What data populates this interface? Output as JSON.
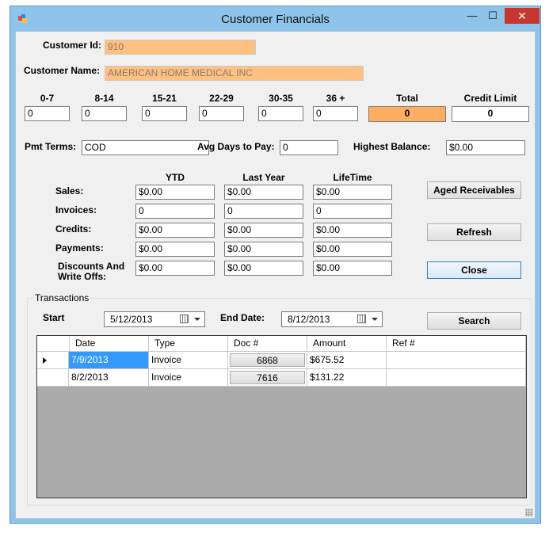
{
  "window": {
    "title": "Customer Financials",
    "minimize": "—",
    "maximize": "☐",
    "close": "✕"
  },
  "customer": {
    "id_label": "Customer Id:",
    "id_value": "910",
    "name_label": "Customer Name:",
    "name_value": "AMERICAN HOME MEDICAL INC"
  },
  "aging": [
    {
      "label": "0-7",
      "value": "0"
    },
    {
      "label": "8-14",
      "value": "0"
    },
    {
      "label": "15-21",
      "value": "0"
    },
    {
      "label": "22-29",
      "value": "0"
    },
    {
      "label": "30-35",
      "value": "0"
    },
    {
      "label": "36 +",
      "value": "0"
    },
    {
      "label": "Total",
      "value": "0"
    },
    {
      "label": "Credit Limit",
      "value": "0"
    }
  ],
  "terms": {
    "pmt_label": "Pmt Terms:",
    "pmt_value": "COD",
    "avg_label": "Avg Days to Pay:",
    "avg_value": "0",
    "high_label": "Highest Balance:",
    "high_value": "$0.00"
  },
  "summary": {
    "columns": [
      "YTD",
      "Last Year",
      "LifeTime"
    ],
    "rows": [
      {
        "label": "Sales:",
        "values": [
          "$0.00",
          "$0.00",
          "$0.00"
        ]
      },
      {
        "label": "Invoices:",
        "values": [
          "0",
          "0",
          "0"
        ]
      },
      {
        "label": "Credits:",
        "values": [
          "$0.00",
          "$0.00",
          "$0.00"
        ]
      },
      {
        "label": "Payments:",
        "values": [
          "$0.00",
          "$0.00",
          "$0.00"
        ]
      },
      {
        "label_line1": "Discounts And",
        "label_line2": "Write Offs:",
        "values": [
          "$0.00",
          "$0.00",
          "$0.00"
        ]
      }
    ]
  },
  "buttons": {
    "aged": "Aged Receivables",
    "refresh": "Refresh",
    "close": "Close",
    "search": "Search"
  },
  "transactions": {
    "group_title": "Transactions",
    "start_label": "Start",
    "start_value": "5/12/2013",
    "end_label": "End Date:",
    "end_value": "8/12/2013",
    "columns": [
      "Date",
      "Type",
      "Doc #",
      "Amount",
      "Ref #"
    ],
    "rows": [
      {
        "date": "7/9/2013",
        "type": "Invoice",
        "doc": "6868",
        "amount": "$675.52",
        "ref": ""
      },
      {
        "date": "8/2/2013",
        "type": "Invoice",
        "doc": "7616",
        "amount": "$131.22",
        "ref": ""
      }
    ]
  }
}
